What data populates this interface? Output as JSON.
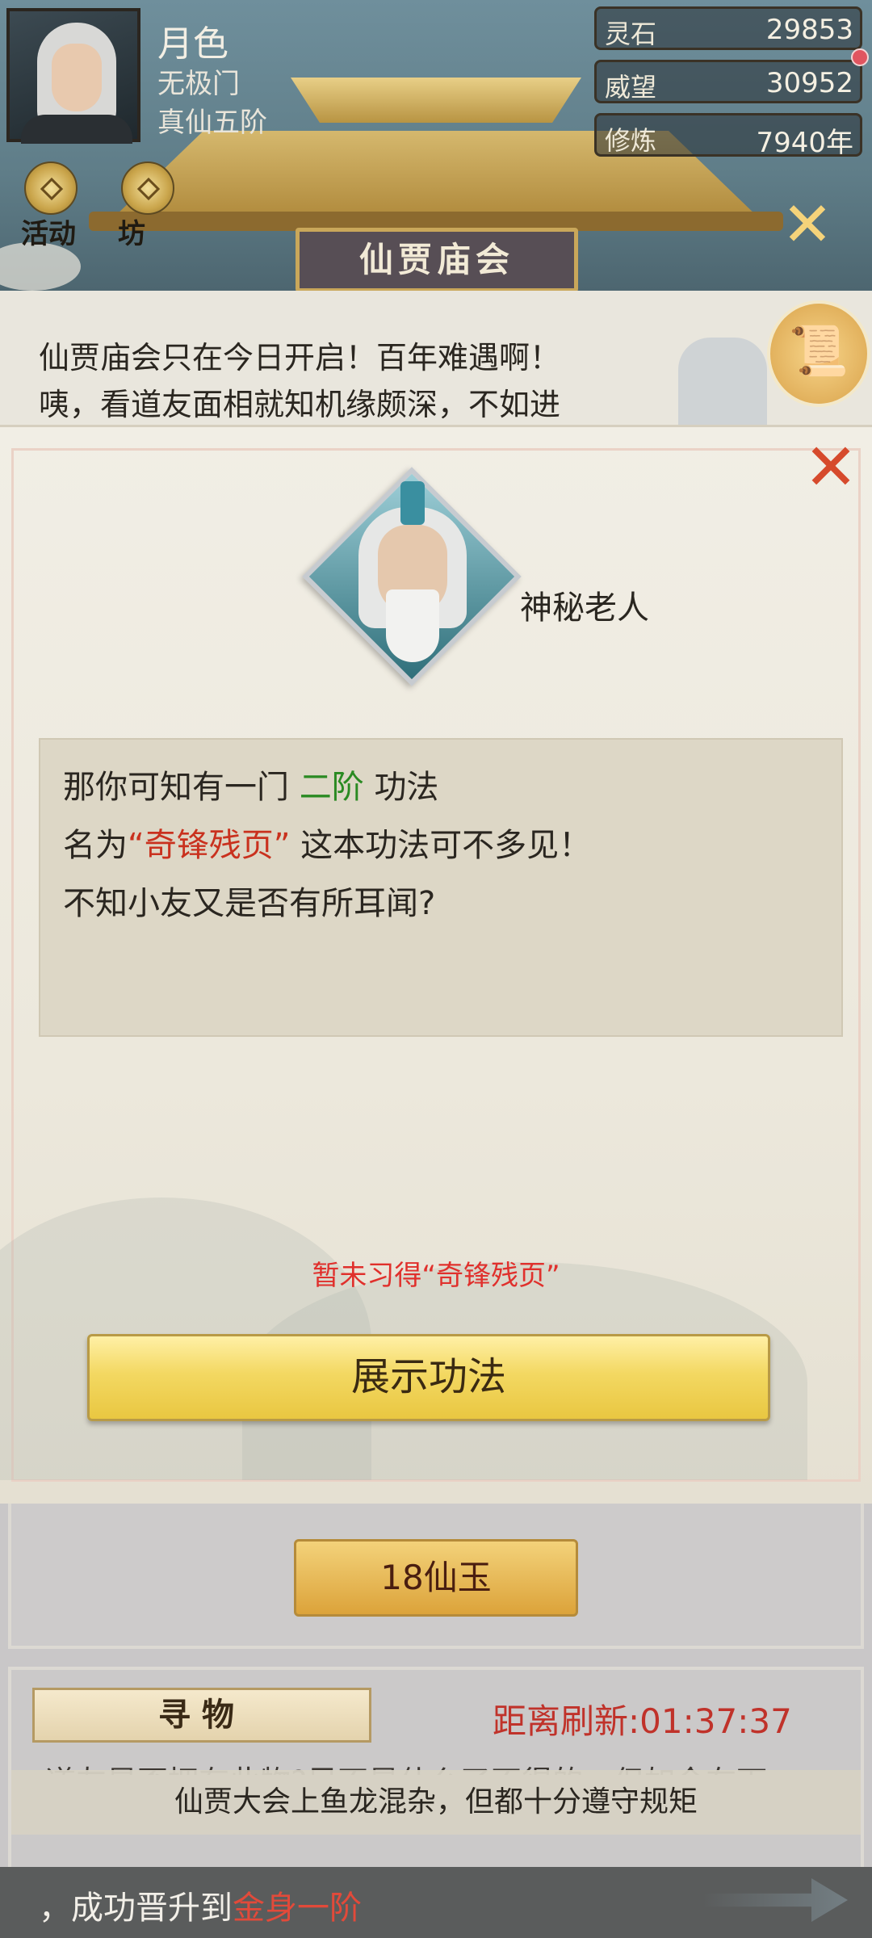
{
  "player": {
    "name": "月色",
    "sect": "无极门",
    "rank": "真仙五阶"
  },
  "stats": [
    {
      "label": "灵石",
      "value": "29853"
    },
    {
      "label": "威望",
      "value": "30952"
    },
    {
      "label": "修炼",
      "value": "7940年"
    }
  ],
  "nav": {
    "item1": "活动",
    "item2": "坊"
  },
  "event": {
    "title": "仙贾庙会",
    "speech_line1": "仙贾庙会只在今日开启！百年难遇啊！",
    "speech_line2": "咦，看道友面相就知机缘颇深，不如进"
  },
  "modal": {
    "npc_name": "神秘老人",
    "line1_a": "那你可知有一门",
    "line1_grade": "二阶",
    "line1_b": "功法",
    "line2_a": "名为",
    "line2_skill": "“奇锋残页”",
    "line2_b": "这本功法可不多见！",
    "line3": "不知小友又是否有所耳闻?",
    "warning": "暂未习得“奇锋残页”",
    "button": "展示功法"
  },
  "shop": {
    "price_button": "18仙玉"
  },
  "seek": {
    "tag": "寻物",
    "refresh_label": "距离刷新:",
    "refresh_time": "01:37:37",
    "partial_text": "道友是否拥有此物?另不是什么了不得的，但如今在下"
  },
  "toast": "仙贾大会上鱼龙混杂，但都十分遵守规矩",
  "news": {
    "prefix": "，成功晋升到",
    "realm": "金身一阶"
  },
  "colors": {
    "accent_gold": "#e9c741",
    "highlight_red": "#c9311e",
    "grade_green": "#2a8a22"
  }
}
